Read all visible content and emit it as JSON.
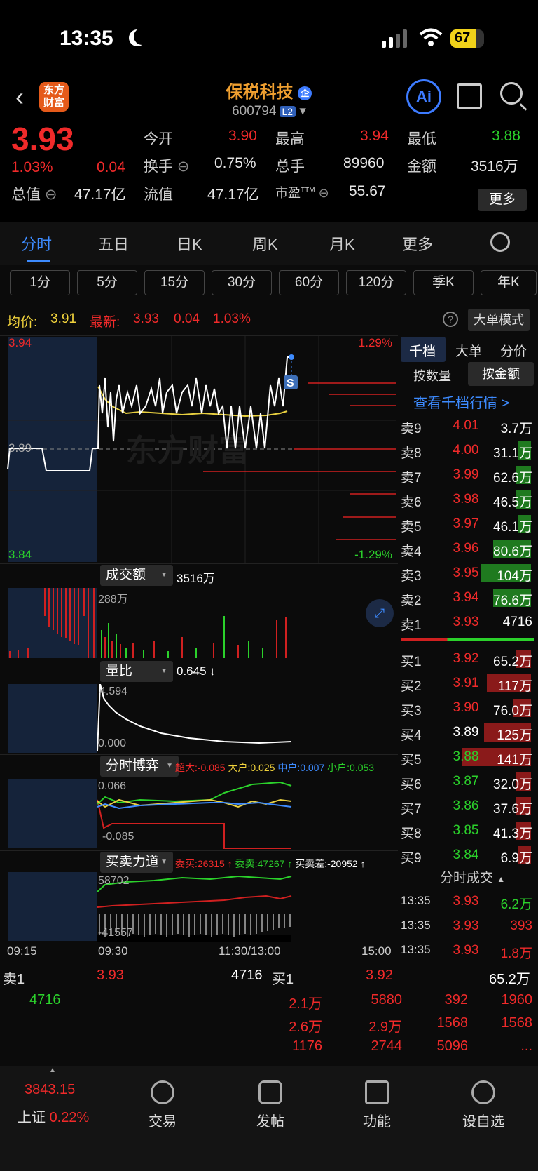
{
  "status": {
    "time": "13:35",
    "battery": "67"
  },
  "header": {
    "title": "保税科技",
    "title_badge": "企",
    "code": "600794",
    "level": "L2",
    "logo_text": "东方财富",
    "ai_label": "Ai"
  },
  "quote": {
    "price": "3.93",
    "change_pct": "1.03%",
    "change": "0.04",
    "open_label": "今开",
    "open": "3.90",
    "high_label": "最高",
    "high": "3.94",
    "low_label": "最低",
    "low": "3.88",
    "turnover_label": "换手",
    "turnover": "0.75%",
    "volume_label": "总手",
    "volume": "89960",
    "amount_label": "金额",
    "amount": "3516万",
    "mcap_label": "总值",
    "mcap": "47.17亿",
    "float_label": "流值",
    "float": "47.17亿",
    "pe_label": "市盈",
    "pe_sup": "TTM",
    "pe": "55.67",
    "more": "更多"
  },
  "tabs": [
    "分时",
    "五日",
    "日K",
    "周K",
    "月K",
    "更多"
  ],
  "periods": [
    "1分",
    "5分",
    "15分",
    "30分",
    "60分",
    "120分",
    "季K",
    "年K"
  ],
  "infobar": {
    "avg_label": "均价:",
    "avg": "3.91",
    "latest_label": "最新:",
    "latest": "3.93",
    "chg": "0.04",
    "pct": "1.03%",
    "mode": "大单模式"
  },
  "chart": {
    "y_top": "3.94",
    "y_mid": "3.89",
    "y_bot": "3.84",
    "pct_top": "1.29%",
    "pct_bot": "-1.29%",
    "watermark": "东方财富",
    "amount_label": "成交额",
    "amount_value": "3516万",
    "amount_max": "288万",
    "ratio_label": "量比",
    "ratio_value": "0.645 ↓",
    "ratio_max": "4.594",
    "ratio_min": "0.000",
    "game_label": "分时博弈",
    "game_super": "超大:-0.085",
    "game_big": "大户:0.025",
    "game_mid": "中户:0.007",
    "game_small": "小户:0.053",
    "game_max": "0.066",
    "game_min": "-0.085",
    "force_label": "买卖力道",
    "force_buy": "委买:26315 ↑",
    "force_sell": "委卖:47267 ↑",
    "force_diff": "买卖差:-20952 ↑",
    "force_max": "58702",
    "force_min": "-41557",
    "t0": "09:15",
    "t1": "09:30",
    "t2": "11:30/13:00",
    "t3": "15:00",
    "s_marker": "S"
  },
  "orderbook": {
    "tabs": [
      "千档",
      "大单",
      "分价"
    ],
    "sub": [
      "按数量",
      "按金额"
    ],
    "link": "查看千档行情 >",
    "sells": [
      {
        "label": "卖9",
        "price": "4.01",
        "vol": "3.7万",
        "bar": 0
      },
      {
        "label": "卖8",
        "price": "4.00",
        "vol": "31.1万",
        "bar": 0.1
      },
      {
        "label": "卖7",
        "price": "3.99",
        "vol": "62.6万",
        "bar": 0.12
      },
      {
        "label": "卖6",
        "price": "3.98",
        "vol": "46.5万",
        "bar": 0.12
      },
      {
        "label": "卖5",
        "price": "3.97",
        "vol": "46.1万",
        "bar": 0.1
      },
      {
        "label": "卖4",
        "price": "3.96",
        "vol": "80.6万",
        "bar": 0.3
      },
      {
        "label": "卖3",
        "price": "3.95",
        "vol": "104万",
        "bar": 0.4
      },
      {
        "label": "卖2",
        "price": "3.94",
        "vol": "76.6万",
        "bar": 0.3
      },
      {
        "label": "卖1",
        "price": "3.93",
        "vol": "4716",
        "bar": 0
      }
    ],
    "buys": [
      {
        "label": "买1",
        "price": "3.92",
        "vol": "65.2万",
        "bar": 0.12
      },
      {
        "label": "买2",
        "price": "3.91",
        "vol": "117万",
        "bar": 0.35
      },
      {
        "label": "买3",
        "price": "3.90",
        "vol": "76.0万",
        "bar": 0.14
      },
      {
        "label": "买4",
        "price": "3.89",
        "vol": "125万",
        "bar": 0.37
      },
      {
        "label": "买5",
        "price": "3.88",
        "vol": "141万",
        "bar": 0.55
      },
      {
        "label": "买6",
        "price": "3.87",
        "vol": "32.0万",
        "bar": 0.12
      },
      {
        "label": "买7",
        "price": "3.86",
        "vol": "37.6万",
        "bar": 0.12
      },
      {
        "label": "买8",
        "price": "3.85",
        "vol": "41.3万",
        "bar": 0.12
      },
      {
        "label": "买9",
        "price": "3.84",
        "vol": "6.9万",
        "bar": 0.1
      }
    ],
    "trades_label": "分时成交",
    "trades": [
      {
        "time": "13:35",
        "price": "3.93",
        "vol": "6.2万"
      },
      {
        "time": "13:35",
        "price": "3.93",
        "vol": "393"
      },
      {
        "time": "13:35",
        "price": "3.93",
        "vol": "1.8万"
      }
    ]
  },
  "bottom": {
    "sell1_label": "卖1",
    "sell1_price": "3.93",
    "sell1_vol": "4716",
    "buy1_label": "买1",
    "buy1_price": "3.92",
    "buy1_vol": "65.2万",
    "sell_queue": [
      "4716"
    ],
    "buy_queue": [
      [
        "2.1万",
        "5880",
        "392",
        "1960"
      ],
      [
        "2.6万",
        "2.9万",
        "1568",
        "1568"
      ],
      [
        "1176",
        "2744",
        "5096",
        "..."
      ]
    ]
  },
  "nav": {
    "index_value": "3843.15",
    "index_name": "上证",
    "index_pct": "0.22%",
    "items": [
      "交易",
      "发帖",
      "功能",
      "设自选"
    ]
  }
}
